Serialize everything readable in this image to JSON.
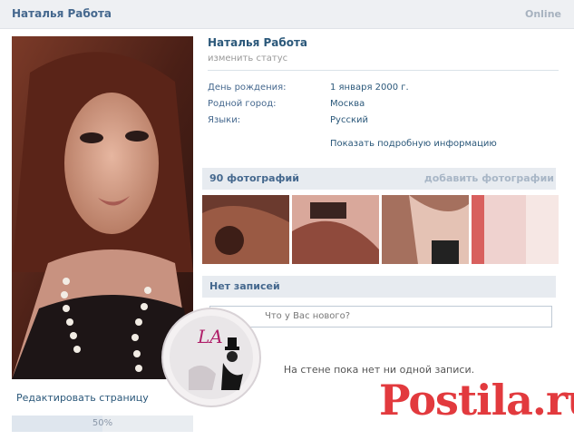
{
  "header": {
    "name": "Наталья Работа",
    "online": "Online"
  },
  "profile": {
    "name": "Наталья Работа",
    "status_placeholder": "изменить статус",
    "info": [
      {
        "key": "День рождения:",
        "value": "1 января 2000 г."
      },
      {
        "key": "Родной город:",
        "value": "Москва"
      },
      {
        "key": "Языки:",
        "value": "Русский"
      }
    ],
    "more_info_link": "Показать подробную информацию",
    "edit_page": "Редактировать страницу",
    "progress_label": "50%",
    "progress_fraction": 0.5
  },
  "photos": {
    "title": "90 фотографий",
    "add_link": "добавить фотографии"
  },
  "wall": {
    "title": "Нет записей",
    "input_placeholder": "Что у Вас нового?",
    "empty_text": "На стене пока нет ни одной записи."
  },
  "badge": {
    "text": "LA"
  },
  "watermark": {
    "text": "Postila.ru"
  },
  "colors": {
    "accent": "#2b587a",
    "header_bg": "#e7ebf0",
    "watermark": "#e23a3e"
  }
}
